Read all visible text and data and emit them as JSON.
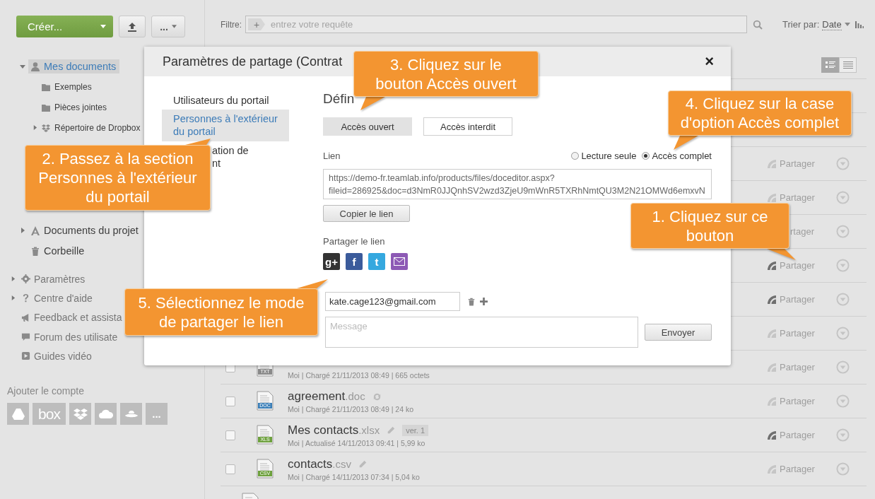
{
  "toolbar": {
    "create_label": "Créer...",
    "more_label": "..."
  },
  "filter": {
    "label": "Filtre:",
    "add_label": "+",
    "placeholder": "entrez votre requête",
    "sort_label": "Trier par:",
    "sort_value": "Date"
  },
  "tree": [
    {
      "label": "Mes documents",
      "kind": "user",
      "expanded": true,
      "selected": true,
      "children": [
        {
          "label": "Exemples",
          "kind": "folder",
          "selected": false
        },
        {
          "label": "Pièces jointes",
          "kind": "folder",
          "selected": false
        },
        {
          "label": "Répertoire de Dropbox",
          "kind": "dropbox",
          "expanded": false,
          "selected": false
        }
      ]
    },
    {
      "label": "Documents du projet",
      "kind": "project",
      "expanded": false,
      "selected": false
    },
    {
      "label": "Corbeille",
      "kind": "trash",
      "selected": false
    }
  ],
  "help_menu": [
    {
      "label": "Paramètres",
      "kind": "gear",
      "expanded": false
    },
    {
      "label": "Centre d'aide",
      "kind": "help",
      "expanded": false
    },
    {
      "label": "Feedback et assista",
      "kind": "megaphone"
    },
    {
      "label": "Forum des utilisate",
      "kind": "chat"
    },
    {
      "label": "Guides vidéo",
      "kind": "play"
    }
  ],
  "accounts": {
    "title": "Ajouter le compte",
    "items": [
      {
        "kind": "drive"
      },
      {
        "kind": "box",
        "label": "box"
      },
      {
        "kind": "dropbox"
      },
      {
        "kind": "cloud"
      },
      {
        "kind": "ufo"
      },
      {
        "kind": "more",
        "label": "..."
      }
    ]
  },
  "files": [
    {
      "share_label": "Partager",
      "shared": false
    },
    {
      "share_label": "Partager",
      "shared": false
    },
    {
      "share_label": "rtager"
    },
    {
      "share_label": "Partager",
      "shared": true
    },
    {
      "share_label": "Partager",
      "shared": true
    },
    {
      "share_label": "Partager",
      "shared": false
    },
    {
      "kind": "txt",
      "checked": false,
      "icon_label": "TXT",
      "meta": "Moi | Chargé 21/11/2013 08:49 | 665 octets",
      "share_label": "Partager",
      "shared": false
    },
    {
      "kind": "doc",
      "checked": false,
      "icon_label": "DOC",
      "name": "agreement",
      "ext": ".doc",
      "syncing": true,
      "editable": false,
      "meta": "Moi | Chargé 21/11/2013 08:49 | 24 ko",
      "share_label": "Partager",
      "shared": false
    },
    {
      "kind": "xls",
      "checked": false,
      "icon_label": "XLS",
      "name": "Mes contacts",
      "ext": ".xlsx",
      "syncing": false,
      "editable": true,
      "badge": "ver. 1",
      "meta": "Moi | Actualisé 14/11/2013 09:41 | 5,99 ko",
      "share_label": "Partager",
      "shared": true
    },
    {
      "kind": "csv",
      "checked": false,
      "icon_label": "CSV",
      "name": "contacts",
      "ext": ".csv",
      "syncing": false,
      "editable": true,
      "meta": "Moi | Chargé 14/11/2013 07:34 | 5,04 ko",
      "share_label": "Partager",
      "shared": false
    },
    {
      "kind": "image"
    }
  ],
  "dialog": {
    "title": "Paramètres de partage (Contrat",
    "close": "×",
    "nav": [
      {
        "label": "Utilisateurs du portail",
        "selected": false
      },
      {
        "label": "Personnes à l'extérieur du portail",
        "selected": true
      },
      {
        "label": "ation de nt",
        "selected": false
      }
    ],
    "heading": "Défin",
    "access_buttons": [
      {
        "label": "Accès ouvert",
        "selected": true
      },
      {
        "label": "Accès interdit",
        "selected": false
      }
    ],
    "link_label": "Lien",
    "rights": [
      {
        "label": "Lecture seule",
        "selected": false
      },
      {
        "label": "Accès complet",
        "selected": true
      }
    ],
    "link_lines": [
      "https://demo-fr.teamlab.info/products/files/doceditor.aspx?",
      "fileid=286925&doc=d3NmR0JJQnhSV2wzd3ZjeU9mWnR5TXRhNmtQU3M2N21OMWd6emxvN"
    ],
    "copy_button": "Copier le lien",
    "share_title": "Partager le lien",
    "share_networks": [
      {
        "kind": "gplus",
        "label": "g+"
      },
      {
        "kind": "facebook",
        "label": "f"
      },
      {
        "kind": "twitter",
        "label": "t"
      },
      {
        "kind": "email"
      }
    ],
    "email": "kate.cage123@gmail.com",
    "message_placeholder": "Message",
    "send_button": "Envoyer"
  },
  "callouts": [
    {
      "text": "1. Cliquez sur ce\nbouton"
    },
    {
      "text": "2. Passez à la section\nPersonnes à l'extérieur\ndu portail"
    },
    {
      "text": "3. Cliquez sur le\nbouton Accès ouvert"
    },
    {
      "text": "4. Cliquez sur la case\nd'option Accès complet"
    },
    {
      "text": "5. Sélectionnez le mode\nde partager le lien"
    }
  ]
}
